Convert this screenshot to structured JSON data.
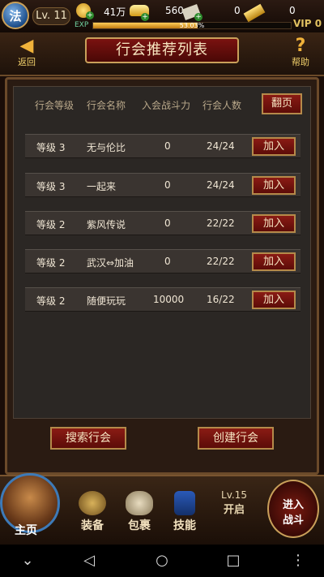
{
  "status": {
    "avatar_char": "法",
    "level": "Lv. 11",
    "coins": "41万",
    "gold": "560",
    "tickets": "0",
    "bars": "0",
    "exp_label": "EXP",
    "exp_text": "53.03%",
    "exp_fraction": 0.5303,
    "vip": "VIP 0"
  },
  "header": {
    "back_label": "返回",
    "title": "行会推荐列表",
    "help_label": "帮助"
  },
  "table": {
    "columns": [
      "行会等级",
      "行会名称",
      "入会战斗力",
      "行会人数"
    ],
    "page_button": "翻页",
    "join_label": "加入",
    "rows": [
      {
        "level": "等级 3",
        "name": "无与伦比",
        "power": "0",
        "members": "24/24"
      },
      {
        "level": "等级 3",
        "name": "一起来",
        "power": "0",
        "members": "24/24"
      },
      {
        "level": "等级 2",
        "name": "紫风传说",
        "power": "0",
        "members": "22/22"
      },
      {
        "level": "等级 2",
        "name": "武汉⇔加油",
        "power": "0",
        "members": "22/22"
      },
      {
        "level": "等级 2",
        "name": "随便玩玩",
        "power": "10000",
        "members": "16/22"
      }
    ]
  },
  "actions": {
    "search": "搜索行会",
    "create": "创建行会"
  },
  "nav": {
    "home": "主页",
    "equip": "装备",
    "bag": "包裹",
    "skill": "技能",
    "lv15_top": "Lv.15",
    "lv15_bottom": "开启",
    "battle_line1": "进入",
    "battle_line2": "战斗"
  }
}
